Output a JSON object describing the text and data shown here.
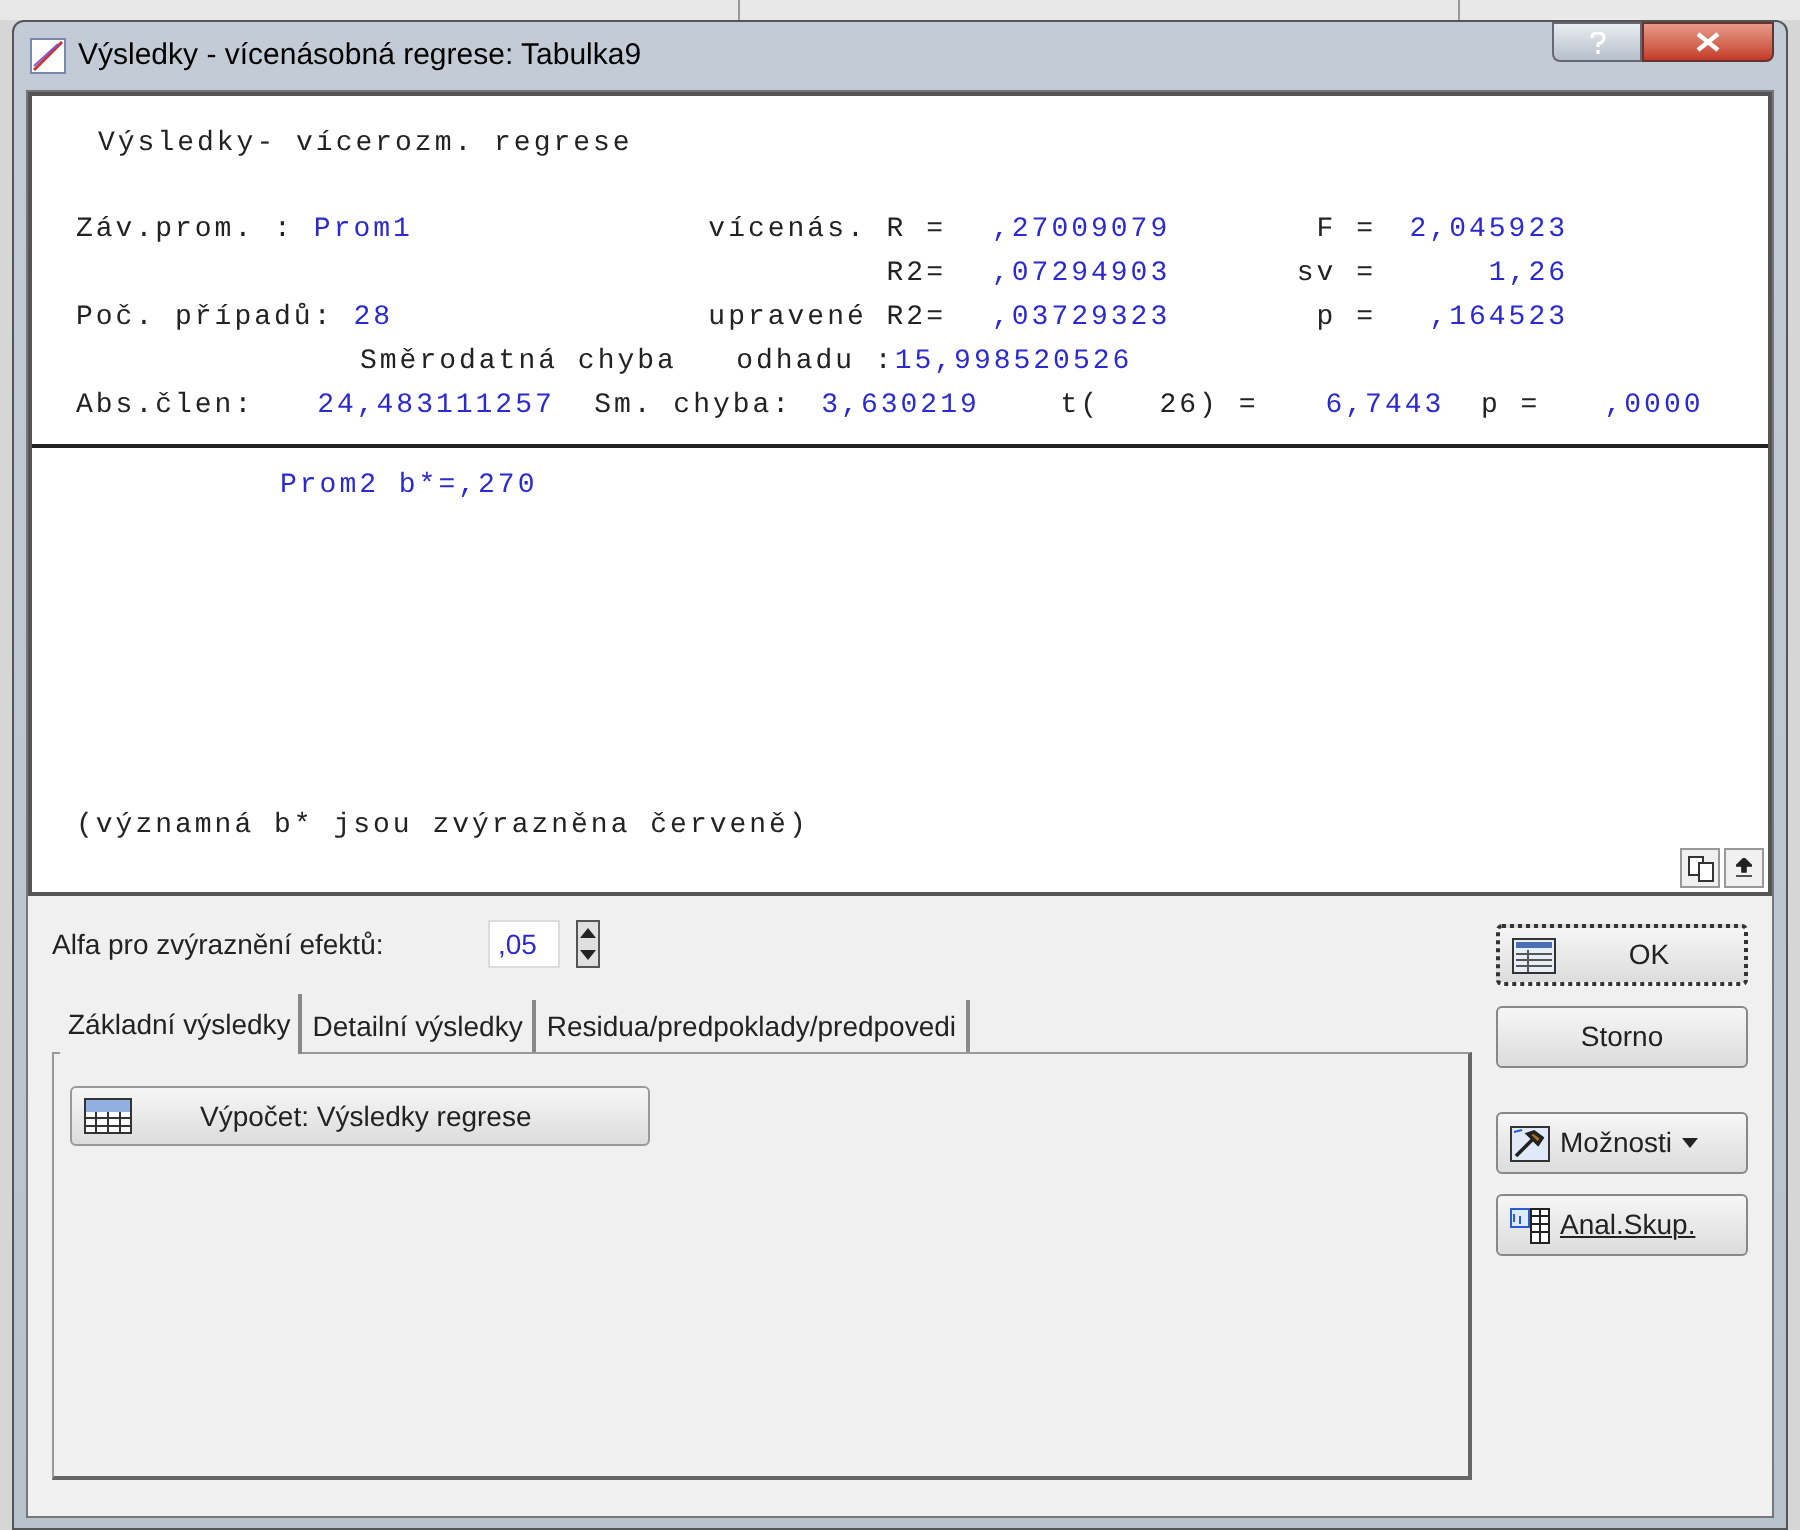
{
  "window": {
    "title": "Výsledky - vícenásobná regrese: Tabulka9"
  },
  "report": {
    "lines": [
      {
        "kind": "heading",
        "text": "Výsledky- vícerozm. regrese"
      },
      {
        "kind": "stat",
        "label1": "Záv.prom. :",
        "value1": "Prom1",
        "label2": "vícenás. R =",
        "value2": ",27009079",
        "label3": "F =",
        "value3": "2,045923"
      },
      {
        "kind": "stat",
        "label2": "R2=",
        "value2": ",07294903",
        "label3": "sv =",
        "value3": "1,26"
      },
      {
        "kind": "stat",
        "label1": "Poč. případů:",
        "value1": "28",
        "label2": "upravené R2=",
        "value2": ",03729323",
        "label3": "p =",
        "value3": ",164523"
      },
      {
        "kind": "error",
        "label": "Směrodatná chyba   odhadu :",
        "value": "15,998520526"
      },
      {
        "kind": "intercept",
        "cells": [
          {
            "kind": "label",
            "text": "Abs.člen:"
          },
          {
            "kind": "value",
            "text": "24,483111257"
          },
          {
            "kind": "label",
            "text": "Sm. chyba:"
          },
          {
            "kind": "value",
            "text": "3,630219"
          },
          {
            "kind": "label",
            "text": "t(   26) ="
          },
          {
            "kind": "value",
            "text": "6,7443"
          },
          {
            "kind": "label",
            "text": "p ="
          },
          {
            "kind": "value",
            "text": ",0000"
          }
        ]
      }
    ],
    "coefficients": [
      "Prom2 b*=,270"
    ],
    "note": "(významná b* jsou zvýrazněna červeně)"
  },
  "alpha": {
    "label": "Alfa pro zvýraznění efektů:",
    "value": ",05"
  },
  "tabs": [
    {
      "label": "Základní výsledky",
      "selected": true
    },
    {
      "label": "Detailní výsledky",
      "selected": false
    },
    {
      "label": "Residua/predpoklady/predpovedi",
      "selected": false
    }
  ],
  "tab_button": "Výpočet:  Výsledky regrese",
  "buttons": [
    {
      "kind": "ok",
      "label": "OK"
    },
    {
      "kind": "cancel",
      "label": "Storno"
    },
    {
      "kind": "options",
      "label": "Možnosti"
    },
    {
      "kind": "groups",
      "label": "Anal.Skup."
    }
  ]
}
